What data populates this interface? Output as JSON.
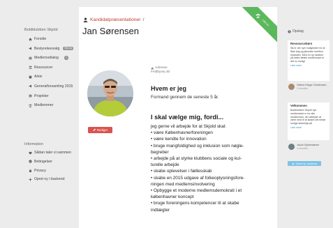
{
  "left_sidebar": {
    "club": "Boldklubben Skjold",
    "nav": [
      {
        "label": "Forside",
        "icon": "home-icon"
      },
      {
        "label": "Bestyrelsesvalg",
        "icon": "megaphone-icon",
        "badge": "Vis nu"
      },
      {
        "label": "Medlemsdialog",
        "icon": "list-icon",
        "badge_count": "5"
      },
      {
        "label": "Ressourcer",
        "icon": "people-icon"
      },
      {
        "label": "Arkiv",
        "icon": "archive-icon"
      },
      {
        "label": "Generalforsamling 2015",
        "icon": "megaphone-icon"
      },
      {
        "label": "Projekter",
        "icon": "list-icon"
      },
      {
        "label": "Medlemmer",
        "icon": "group-icon"
      }
    ],
    "info_title": "Information",
    "info_nav": [
      {
        "label": "Sådan taler vi sammen",
        "icon": "heart-icon"
      },
      {
        "label": "Betingelser",
        "icon": "check-circle-icon"
      },
      {
        "label": "Privacy",
        "icon": "lock-icon"
      },
      {
        "label": "Opret ny i backend",
        "icon": "plus-icon"
      }
    ]
  },
  "main": {
    "breadcrumb_link": "Kandidatpræsentationer",
    "breadcrumb_sep": "/",
    "title": "Jan Sørensen",
    "ribbon": "Læs nu",
    "edit_label": "Rediger",
    "address_label": "Adresse",
    "address_value": "Feldbyvej 30",
    "who_heading": "Hvem er jeg",
    "who_text": "Formand gennem de seneste 5 år.",
    "choose_heading": "I skal vælge mig, fordi...",
    "body_lines": [
      "jeg gerne vil arbejde for at Skjold skal:",
      "• være Københavnerforeningen",
      "• være kendte for innovation",
      "• bruge mangfoldighed og inklusion som nøgle-",
      "begreber",
      "• arbejde på at styrke klubbens sociale og kul-",
      "turelle arbejde",
      "• skabe oplevelser i fællesskab",
      "• skabe en 2015 udgave af folkeoplysningsfore-",
      "ningen med medlemsinvolvering",
      "• Opbygge et moderne medlemsdemokrati i et",
      "københavner koncept",
      "• bruge foreningens kompetencer til at skabe",
      "indtægter"
    ]
  },
  "right_sidebar": {
    "follow": "Opslag",
    "card1": {
      "title": "Ressourcebørs",
      "text": "Så er der nye muligheder for at låne ting og tjenester imellem hinanden. Med en ny funktion på siden fælles medlemskol er det nu muligt",
      "more": "Læs mere"
    },
    "person1": {
      "name": "Helene Klinge Christensen",
      "time": "2 minutter"
    },
    "card2": {
      "title": "Velkommen",
      "text": "Boldklubben Skjold nye medlemskol er for alle medlemmer, der arbejder at være med til at skabe det bedst mulige klubmiljø på",
      "more": "Læs mere"
    },
    "person2": {
      "name": "Jacob Gyldenkærne",
      "time": "4 minutter"
    },
    "join_label": "Opret ny i backend"
  },
  "colors": {
    "accent_red": "#c0392b",
    "button_red": "#d9534f",
    "ribbon_green": "#5cb85c",
    "link_blue": "#3a8bc5",
    "button_blue": "#7ec3e6"
  }
}
